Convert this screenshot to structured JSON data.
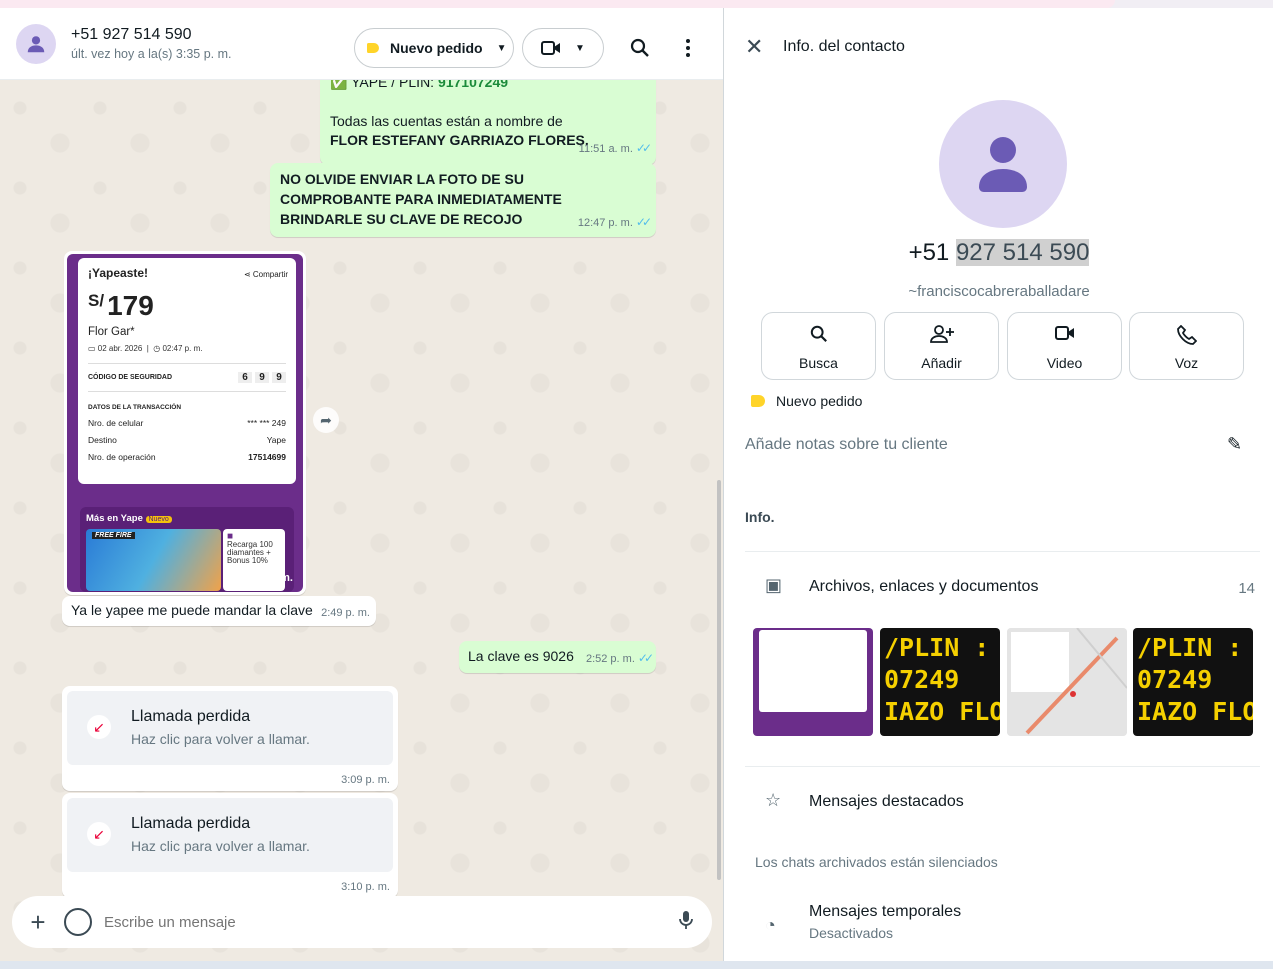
{
  "chat_header": {
    "name": "+51 927 514 590",
    "last_seen": "últ. vez hoy a la(s) 3:35 p. m.",
    "label_button": "Nuevo pedido"
  },
  "messages": [
    {
      "yape_line_prefix": "✅ YAPE / PLIN: ",
      "yape_number": "917107249",
      "text1": "Todas las cuentas están a nombre de",
      "text2": "FLOR ESTEFANY GARRIAZO FLORES.",
      "time": "11:51 a. m."
    },
    {
      "text": "NO OLVIDE ENVIAR LA FOTO DE SU COMPROBANTE PARA INMEDIATAMENTE BRINDARLE SU CLAVE DE RECOJO",
      "time": "12:47 p. m."
    },
    {
      "time": "2:49 p. m."
    },
    {
      "text": "Ya le yapee me puede mandar la clave",
      "time": "2:49 p. m."
    },
    {
      "text": "La clave es 9026",
      "time": "2:52 p. m."
    }
  ],
  "yape_receipt": {
    "title": "¡Yapeaste!",
    "share": "Compartir",
    "currency": "S/",
    "amount": "179",
    "name": "Flor Gar*",
    "date": "02 abr. 2026",
    "hour": "02:47 p. m.",
    "security_label": "CÓDIGO DE SEGURIDAD",
    "security_digits": [
      "6",
      "9",
      "9"
    ],
    "details_label": "DATOS DE LA TRANSACCIÓN",
    "rows": [
      {
        "k": "Nro. de celular",
        "v": "*** *** 249"
      },
      {
        "k": "Destino",
        "v": "Yape"
      },
      {
        "k": "Nro. de operación",
        "v": "17514699"
      }
    ],
    "promo_title": "Más en Yape",
    "promo_badge": "Nuevo",
    "promo_game": "FREE FIRE",
    "promo_side": "Recarga 100 diamantes + Bonus 10%"
  },
  "calls": [
    {
      "title": "Llamada perdida",
      "subtitle": "Haz clic para volver a llamar.",
      "time": "3:09 p. m."
    },
    {
      "title": "Llamada perdida",
      "subtitle": "Haz clic para volver a llamar.",
      "time": "3:10 p. m."
    }
  ],
  "composer": {
    "placeholder": "Escribe un mensaje"
  },
  "info_panel": {
    "title": "Info. del contacto",
    "phone_prefix": "+51 ",
    "phone_rest": "927 514 590",
    "alias": "~franciscocabreraballadare",
    "actions": [
      {
        "label": "Busca",
        "icon": "search-icon"
      },
      {
        "label": "Añadir",
        "icon": "add-person-icon"
      },
      {
        "label": "Video",
        "icon": "video-icon"
      },
      {
        "label": "Voz",
        "icon": "phone-icon"
      }
    ],
    "label": "Nuevo pedido",
    "notes_placeholder": "Añade notas sobre tu cliente",
    "info_section": "Info.",
    "files_label": "Archivos, enlaces y documentos",
    "files_count": "14",
    "thumb_text_1": "/PLIN :",
    "thumb_text_2": "07249",
    "thumb_text_3": "IAZO FLO",
    "starred": "Mensajes destacados",
    "archived_note": "Los chats archivados están silenciados",
    "temp_title": "Mensajes temporales",
    "temp_status": "Desactivados"
  },
  "colors": {
    "outgoing_bubble": "#d9fdd3",
    "chat_bg": "#efeae2",
    "label_yellow": "#ffd429",
    "missed_call_red": "#ea0038",
    "read_ticks": "#53bdeb"
  }
}
